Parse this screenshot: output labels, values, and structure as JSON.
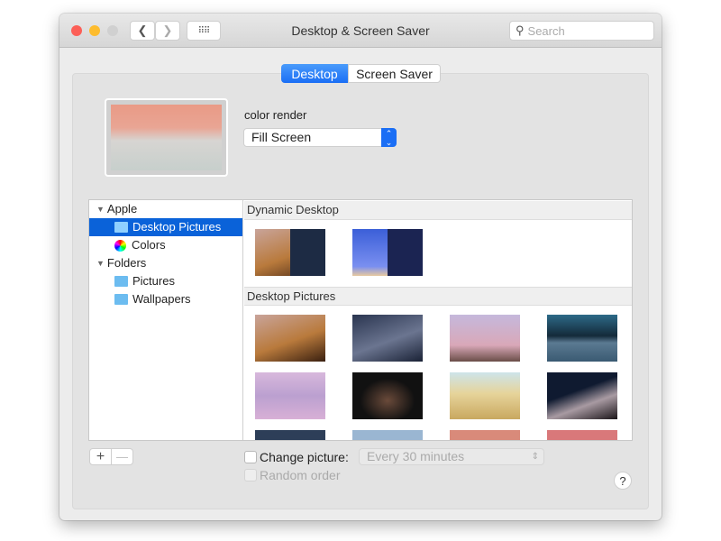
{
  "window": {
    "title": "Desktop & Screen Saver",
    "search_placeholder": "Search"
  },
  "tabs": [
    {
      "label": "Desktop",
      "selected": true
    },
    {
      "label": "Screen Saver",
      "selected": false
    }
  ],
  "current": {
    "name": "color render",
    "fit": "Fill Screen"
  },
  "sidebar": {
    "groups": [
      {
        "label": "Apple",
        "items": [
          {
            "label": "Desktop Pictures",
            "selected": true,
            "icon": "folder-icon"
          },
          {
            "label": "Colors",
            "icon": "color-wheel-icon"
          }
        ]
      },
      {
        "label": "Folders",
        "items": [
          {
            "label": "Pictures",
            "icon": "pictures-folder-icon"
          },
          {
            "label": "Wallpapers",
            "icon": "folder-icon"
          }
        ]
      }
    ]
  },
  "sections": [
    {
      "label": "Dynamic Desktop"
    },
    {
      "label": "Desktop Pictures"
    }
  ],
  "bottom": {
    "add": "+",
    "remove": "—",
    "change_picture": "Change picture:",
    "change_picture_checked": false,
    "interval": "Every 30 minutes",
    "random_order": "Random order",
    "random_checked": false,
    "help": "?"
  },
  "colors": {
    "accent": "#1a6ef5",
    "selection": "#0a62d9"
  }
}
